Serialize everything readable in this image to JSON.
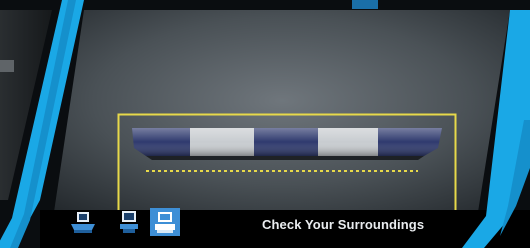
{
  "display": {
    "status_text": "Check Your Surroundings",
    "view_modes": [
      {
        "name": "top-view",
        "icon": "car-top-view-icon",
        "selected": false
      },
      {
        "name": "rear-view",
        "icon": "car-rear-view-icon",
        "selected": false
      },
      {
        "name": "wide-view",
        "icon": "car-wide-view-icon",
        "selected": true
      }
    ],
    "colors": {
      "accent": "#1aa8e6",
      "guide_line": "#e7d94a",
      "selected_mode": "#3e8fd6"
    }
  }
}
